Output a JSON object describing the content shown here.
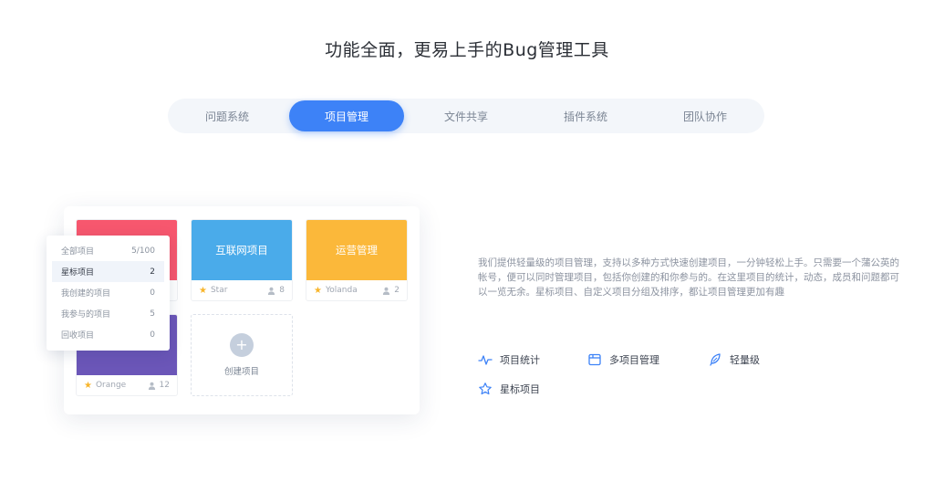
{
  "headline": "功能全面，更易上手的Bug管理工具",
  "tabs": [
    {
      "label": "问题系统",
      "active": false
    },
    {
      "label": "项目管理",
      "active": true
    },
    {
      "label": "文件共享",
      "active": false
    },
    {
      "label": "插件系统",
      "active": false
    },
    {
      "label": "团队协作",
      "active": false
    }
  ],
  "colors": {
    "accent": "#3d82f7",
    "card_red": "#f7576e",
    "card_blue": "#4aabea",
    "card_yellow": "#fbb83a",
    "card_purple": "#6b56b8",
    "star": "#f8b52b"
  },
  "cards": [
    {
      "title": "",
      "owner": "",
      "members": ""
    },
    {
      "title": "互联网项目",
      "owner": "Star",
      "members": "8"
    },
    {
      "title": "运营管理",
      "owner": "Yolanda",
      "members": "2"
    },
    {
      "title": "",
      "owner": "Orange",
      "members": "12"
    }
  ],
  "create_label": "创建项目",
  "filter_list": [
    {
      "label": "全部项目",
      "count": "5/100",
      "active": false
    },
    {
      "label": "星标项目",
      "count": "2",
      "active": true
    },
    {
      "label": "我创建的项目",
      "count": "0",
      "active": false
    },
    {
      "label": "我参与的项目",
      "count": "5",
      "active": false
    },
    {
      "label": "回收项目",
      "count": "0",
      "active": false
    }
  ],
  "description": "我们提供轻量级的项目管理，支持以多种方式快速创建项目，一分钟轻松上手。只需要一个蒲公英的帐号，便可以同时管理项目，包括你创建的和你参与的。在这里项目的统计，动态，成员和问题都可以一览无余。星标项目、自定义项目分组及排序，都让项目管理更加有趣",
  "features": [
    {
      "label": "项目统计",
      "icon": "pulse-icon"
    },
    {
      "label": "多项目管理",
      "icon": "window-icon"
    },
    {
      "label": "轻量级",
      "icon": "feather-icon"
    },
    {
      "label": "星标项目",
      "icon": "star-outline-icon"
    }
  ]
}
